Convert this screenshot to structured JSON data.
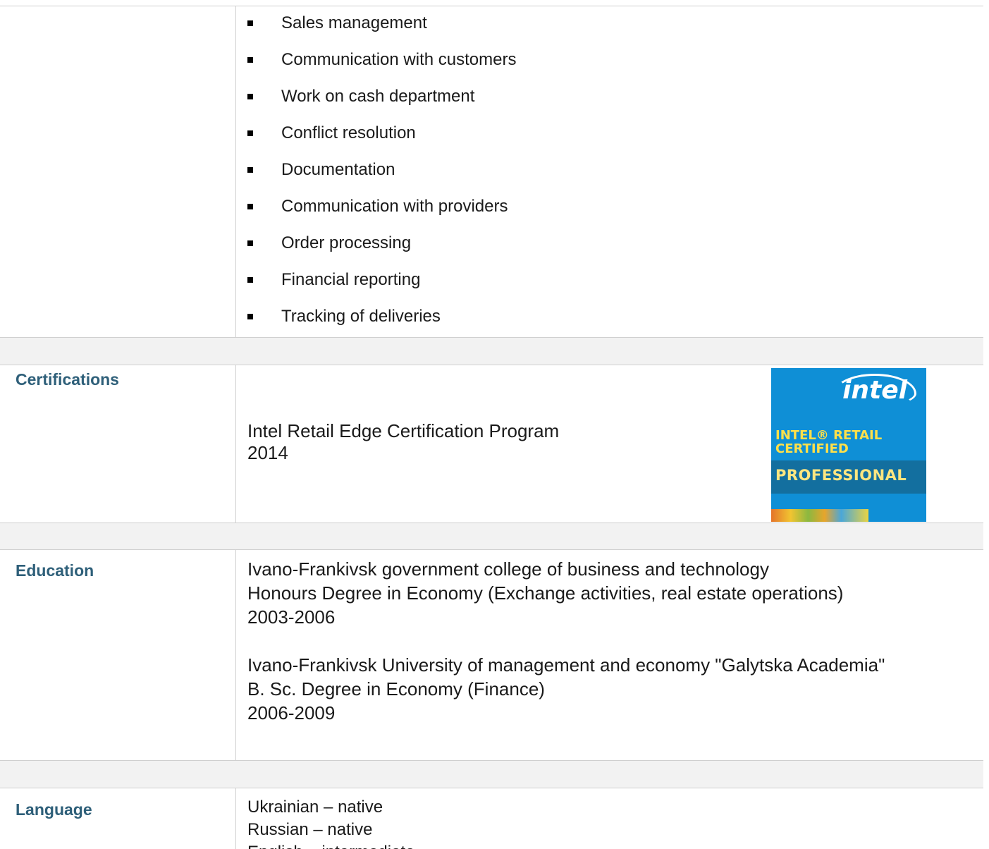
{
  "duties": [
    "Sales management",
    "Communication with customers",
    "Work on cash department",
    "Conflict resolution",
    "Documentation",
    "Communication with providers",
    "Order processing",
    "Financial reporting",
    "Tracking of deliveries"
  ],
  "certifications": {
    "label": "Certifications",
    "name": "Intel Retail Edge Certification Program",
    "year": "2014",
    "badge": {
      "logo": "intel",
      "line1": "INTEL® RETAIL",
      "line2": "CERTIFIED",
      "line3": "PROFESSIONAL"
    }
  },
  "education": {
    "label": "Education",
    "entries": [
      {
        "school": "Ivano-Frankivsk government college of business and technology",
        "degree": "Honours Degree in Economy (Exchange activities, real estate operations)",
        "years": "2003-2006"
      },
      {
        "school": "Ivano-Frankivsk University of management and economy \"Galytska Academia\"",
        "degree": "B. Sc. Degree in Economy (Finance)",
        "years": "2006-2009"
      }
    ]
  },
  "language": {
    "label": "Language",
    "items": [
      "Ukrainian – native",
      "Russian – native",
      "English – intermediate"
    ]
  },
  "colors": {
    "label": "#2e5f79",
    "badge_blue": "#0f8fd6",
    "badge_band": "#136f9f",
    "badge_yellow": "#ffe04a"
  }
}
